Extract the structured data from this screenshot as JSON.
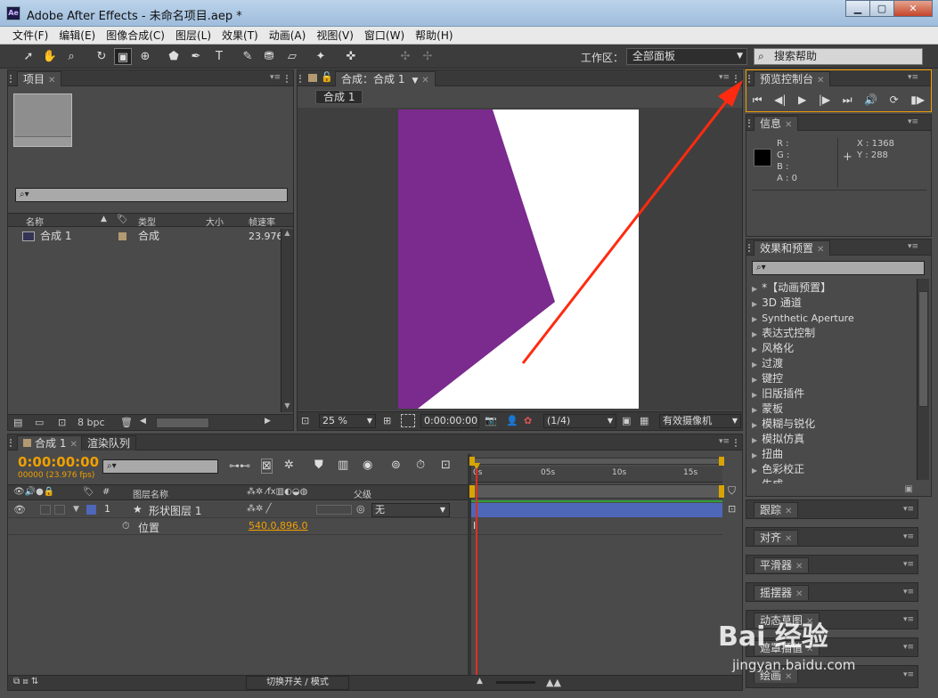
{
  "window": {
    "title": "Adobe After Effects - 未命名项目.aep *",
    "app_badge": "Ae"
  },
  "menu": [
    "文件(F)",
    "编辑(E)",
    "图像合成(C)",
    "图层(L)",
    "效果(T)",
    "动画(A)",
    "视图(V)",
    "窗口(W)",
    "帮助(H)"
  ],
  "toolbar": {
    "workspace_label": "工作区：",
    "workspace_value": "全部面板",
    "help_placeholder": "搜索帮助"
  },
  "project": {
    "tab": "项目",
    "columns": [
      "名称",
      "类型",
      "大小",
      "帧速率"
    ],
    "items": [
      {
        "name": "合成 1",
        "type": "合成",
        "fps": "23.976"
      }
    ],
    "bpc": "8 bpc"
  },
  "composition": {
    "tab": "合成：合成 1",
    "subtab": "合成 1",
    "zoom": "25 %",
    "timecode": "0:00:00:00",
    "resolution": "(1/4)",
    "camera": "有效摄像机"
  },
  "preview": {
    "tab": "预览控制台"
  },
  "info": {
    "tab": "信息",
    "r": "R :",
    "g": "G :",
    "b": "B :",
    "a": "A : 0",
    "x": "X : 1368",
    "y": "Y : 288"
  },
  "effects": {
    "tab": "效果和预置",
    "items": [
      "*【动画预置】",
      "3D 通道",
      "Synthetic Aperture",
      "表达式控制",
      "风格化",
      "过渡",
      "键控",
      "旧版插件",
      "蒙板",
      "模糊与锐化",
      "模拟仿真",
      "扭曲",
      "色彩校正",
      "生成"
    ]
  },
  "collapsed_panels": [
    "跟踪",
    "对齐",
    "平滑器",
    "摇摆器",
    "动态草图",
    "遮罩插值",
    "绘画"
  ],
  "timeline": {
    "tab": "合成 1",
    "tab2": "渲染队列",
    "timecode": "0:00:00:00",
    "fps": "00000 (23.976 fps)",
    "col_layer_name": "图层名称",
    "col_parent": "父级",
    "col_num": "#",
    "layer": {
      "num": "1",
      "name": "形状图层 1",
      "parent": "无"
    },
    "property": {
      "name": "位置",
      "value": "540.0,896.0"
    },
    "ruler": [
      "0s",
      "05s",
      "10s",
      "15s"
    ],
    "toggle_label": "切换开关 / 模式"
  },
  "colors": {
    "purple": "#7b2a8e",
    "accent": "#f0a000",
    "layer_bar": "#4f67b8",
    "playhead": "#e03020"
  }
}
